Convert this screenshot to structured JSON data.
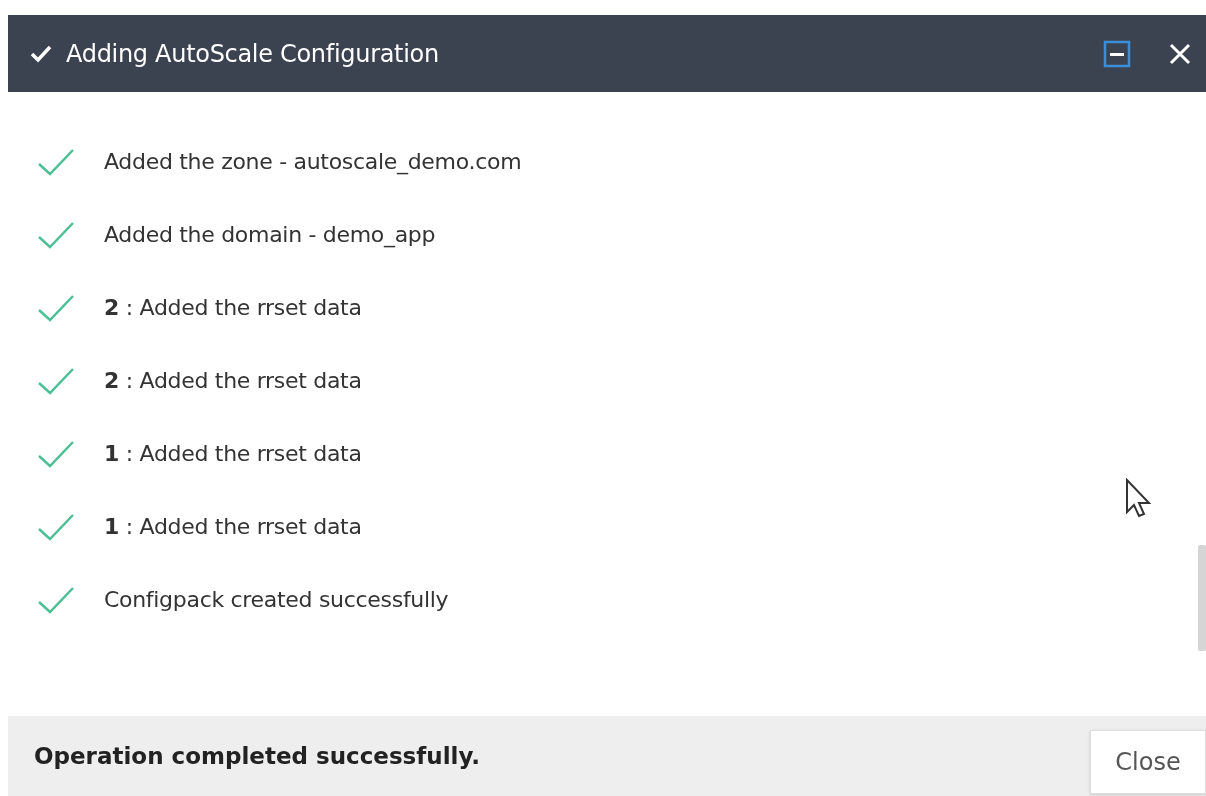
{
  "window": {
    "title": "Adding AutoScale Configuration"
  },
  "steps": [
    {
      "text": "Added the zone - autoscale_demo.com",
      "kind": "success"
    },
    {
      "text": "Added the domain - demo_app",
      "kind": "success"
    },
    {
      "text": "**2** : Added the rrset data",
      "kind": "success"
    },
    {
      "text": "**2** : Added the rrset data",
      "kind": "success"
    },
    {
      "text": "**1** : Added the rrset data",
      "kind": "success"
    },
    {
      "text": "**1** : Added the rrset data",
      "kind": "success"
    },
    {
      "text": "Configpack created successfully",
      "kind": "success"
    }
  ],
  "footer": {
    "message": "Operation completed successfully.",
    "button": "Close"
  }
}
